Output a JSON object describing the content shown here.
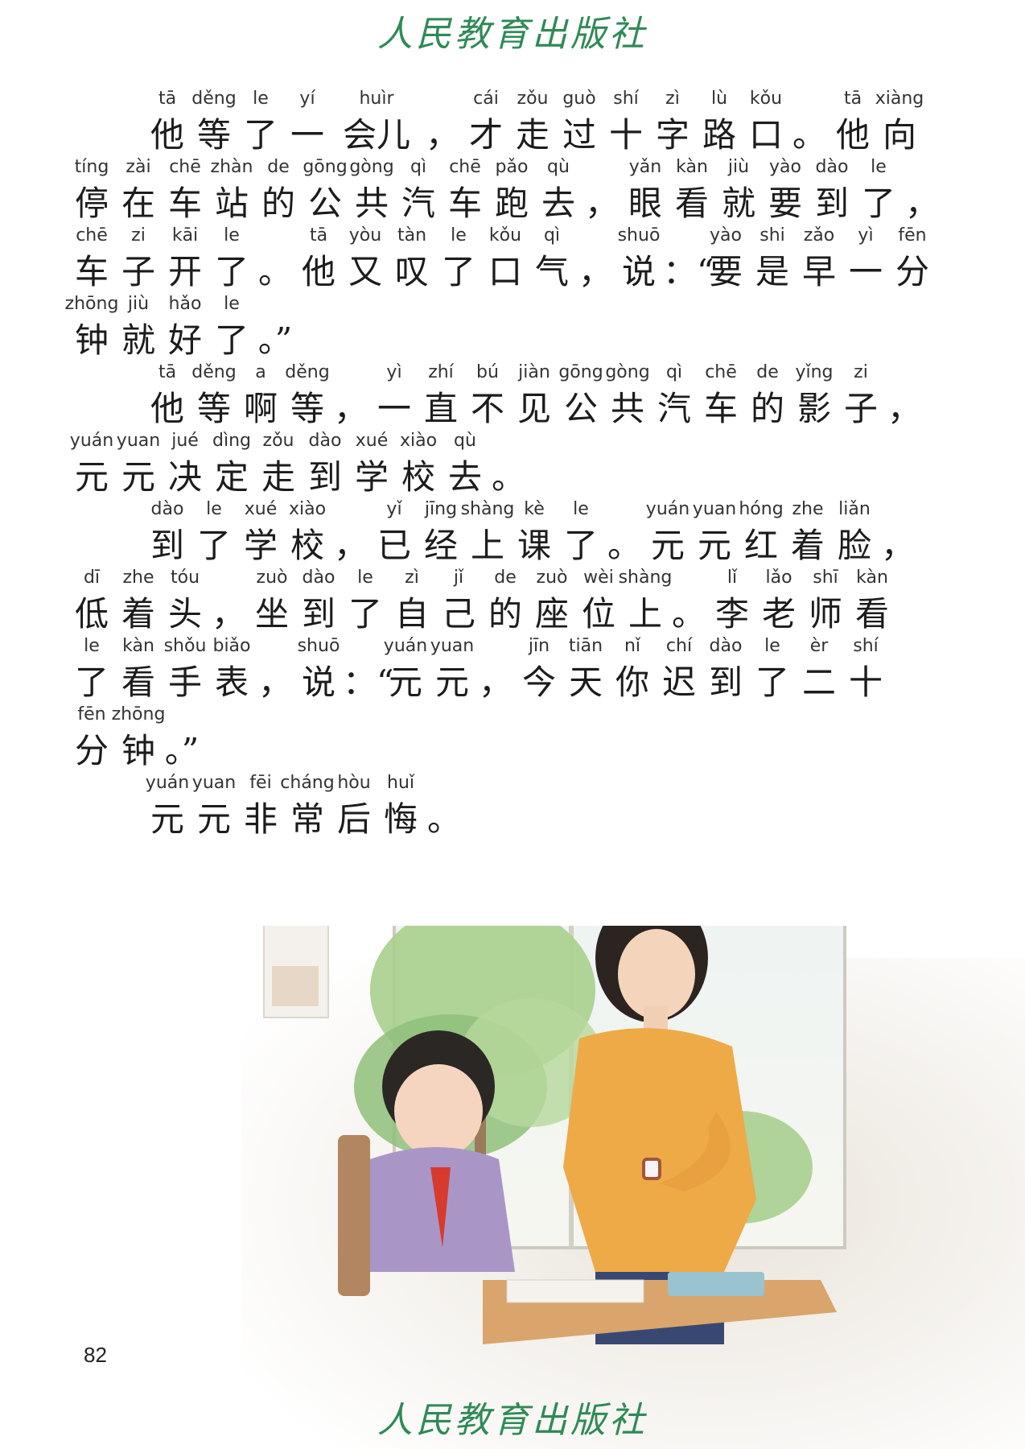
{
  "header": {
    "logo_text": "人民教育出版社"
  },
  "footer": {
    "logo_text": "人民教育出版社",
    "page_number": "82"
  },
  "lines": [
    {
      "indent": true,
      "units": [
        [
          "tā",
          "他"
        ],
        [
          "děng",
          "等"
        ],
        [
          "le",
          "了"
        ],
        [
          "yí",
          "一"
        ],
        [
          "huìr",
          "会儿"
        ],
        [
          "",
          "，"
        ],
        [
          "cái",
          "才"
        ],
        [
          "zǒu",
          "走"
        ],
        [
          "guò",
          "过"
        ],
        [
          "shí",
          "十"
        ],
        [
          "zì",
          "字"
        ],
        [
          "lù",
          "路"
        ],
        [
          "kǒu",
          "口"
        ],
        [
          "",
          "。"
        ],
        [
          "tā",
          "他"
        ],
        [
          "xiàng",
          "向"
        ]
      ]
    },
    {
      "indent": false,
      "units": [
        [
          "tíng",
          "停"
        ],
        [
          "zài",
          "在"
        ],
        [
          "chē",
          "车"
        ],
        [
          "zhàn",
          "站"
        ],
        [
          "de",
          "的"
        ],
        [
          "gōng",
          "公"
        ],
        [
          "gòng",
          "共"
        ],
        [
          "qì",
          "汽"
        ],
        [
          "chē",
          "车"
        ],
        [
          "pǎo",
          "跑"
        ],
        [
          "qù",
          "去"
        ],
        [
          "",
          "，"
        ],
        [
          "yǎn",
          "眼"
        ],
        [
          "kàn",
          "看"
        ],
        [
          "jiù",
          "就"
        ],
        [
          "yào",
          "要"
        ],
        [
          "dào",
          "到"
        ],
        [
          "le",
          "了"
        ],
        [
          "",
          "，"
        ]
      ]
    },
    {
      "indent": false,
      "units": [
        [
          "chē",
          "车"
        ],
        [
          "zi",
          "子"
        ],
        [
          "kāi",
          "开"
        ],
        [
          "le",
          "了"
        ],
        [
          "",
          "。"
        ],
        [
          "tā",
          "他"
        ],
        [
          "yòu",
          "又"
        ],
        [
          "tàn",
          "叹"
        ],
        [
          "le",
          "了"
        ],
        [
          "kǒu",
          "口"
        ],
        [
          "qì",
          "气"
        ],
        [
          "",
          "，"
        ],
        [
          "shuō",
          "说"
        ],
        [
          "",
          "：“"
        ],
        [
          "yào",
          "要"
        ],
        [
          "shi",
          "是"
        ],
        [
          "zǎo",
          "早"
        ],
        [
          "yì",
          "一"
        ],
        [
          "fēn",
          "分"
        ]
      ]
    },
    {
      "indent": false,
      "units": [
        [
          "zhōng",
          "钟"
        ],
        [
          "jiù",
          "就"
        ],
        [
          "hǎo",
          "好"
        ],
        [
          "le",
          "了"
        ],
        [
          "",
          "。”"
        ]
      ]
    },
    {
      "indent": true,
      "units": [
        [
          "tā",
          "他"
        ],
        [
          "děng",
          "等"
        ],
        [
          "a",
          "啊"
        ],
        [
          "děng",
          "等"
        ],
        [
          "",
          "，"
        ],
        [
          "yì",
          "一"
        ],
        [
          "zhí",
          "直"
        ],
        [
          "bú",
          "不"
        ],
        [
          "jiàn",
          "见"
        ],
        [
          "gōng",
          "公"
        ],
        [
          "gòng",
          "共"
        ],
        [
          "qì",
          "汽"
        ],
        [
          "chē",
          "车"
        ],
        [
          "de",
          "的"
        ],
        [
          "yǐng",
          "影"
        ],
        [
          "zi",
          "子"
        ],
        [
          "",
          "，"
        ]
      ]
    },
    {
      "indent": false,
      "units": [
        [
          "yuán",
          "元"
        ],
        [
          "yuan",
          "元"
        ],
        [
          "jué",
          "决"
        ],
        [
          "dìng",
          "定"
        ],
        [
          "zǒu",
          "走"
        ],
        [
          "dào",
          "到"
        ],
        [
          "xué",
          "学"
        ],
        [
          "xiào",
          "校"
        ],
        [
          "qù",
          "去"
        ],
        [
          "",
          "。"
        ]
      ]
    },
    {
      "indent": true,
      "units": [
        [
          "dào",
          "到"
        ],
        [
          "le",
          "了"
        ],
        [
          "xué",
          "学"
        ],
        [
          "xiào",
          "校"
        ],
        [
          "",
          "，"
        ],
        [
          "yǐ",
          "已"
        ],
        [
          "jīng",
          "经"
        ],
        [
          "shàng",
          "上"
        ],
        [
          "kè",
          "课"
        ],
        [
          "le",
          "了"
        ],
        [
          "",
          "。"
        ],
        [
          "yuán",
          "元"
        ],
        [
          "yuan",
          "元"
        ],
        [
          "hóng",
          "红"
        ],
        [
          "zhe",
          "着"
        ],
        [
          "liǎn",
          "脸"
        ],
        [
          "",
          "，"
        ]
      ]
    },
    {
      "indent": false,
      "units": [
        [
          "dī",
          "低"
        ],
        [
          "zhe",
          "着"
        ],
        [
          "tóu",
          "头"
        ],
        [
          "",
          "，"
        ],
        [
          "zuò",
          "坐"
        ],
        [
          "dào",
          "到"
        ],
        [
          "le",
          "了"
        ],
        [
          "zì",
          "自"
        ],
        [
          "jǐ",
          "己"
        ],
        [
          "de",
          "的"
        ],
        [
          "zuò",
          "座"
        ],
        [
          "wèi",
          "位"
        ],
        [
          "shàng",
          "上"
        ],
        [
          "",
          "。"
        ],
        [
          "lǐ",
          "李"
        ],
        [
          "lǎo",
          "老"
        ],
        [
          "shī",
          "师"
        ],
        [
          "kàn",
          "看"
        ]
      ]
    },
    {
      "indent": false,
      "units": [
        [
          "le",
          "了"
        ],
        [
          "kàn",
          "看"
        ],
        [
          "shǒu",
          "手"
        ],
        [
          "biǎo",
          "表"
        ],
        [
          "",
          "，"
        ],
        [
          "shuō",
          "说"
        ],
        [
          "",
          "：“"
        ],
        [
          "yuán",
          "元"
        ],
        [
          "yuan",
          "元"
        ],
        [
          "",
          "，"
        ],
        [
          "jīn",
          "今"
        ],
        [
          "tiān",
          "天"
        ],
        [
          "nǐ",
          "你"
        ],
        [
          "chí",
          "迟"
        ],
        [
          "dào",
          "到"
        ],
        [
          "le",
          "了"
        ],
        [
          "èr",
          "二"
        ],
        [
          "shí",
          "十"
        ]
      ]
    },
    {
      "indent": false,
      "units": [
        [
          "fēn",
          "分"
        ],
        [
          "zhōng",
          "钟"
        ],
        [
          "",
          "。”"
        ]
      ]
    },
    {
      "indent": true,
      "units": [
        [
          "yuán",
          "元"
        ],
        [
          "yuan",
          "元"
        ],
        [
          "fēi",
          "非"
        ],
        [
          "cháng",
          "常"
        ],
        [
          "hòu",
          "后"
        ],
        [
          "huǐ",
          "悔"
        ],
        [
          "",
          "。"
        ]
      ]
    }
  ],
  "colors": {
    "logo": "#2f8a57",
    "text": "#1c1c1c"
  }
}
